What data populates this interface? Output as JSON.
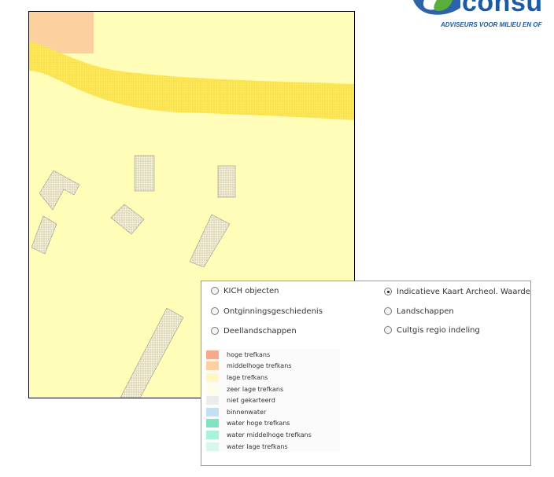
{
  "logo": {
    "text": "consu",
    "tagline": "ADVISEURS VOOR MILIEU EN OF"
  },
  "map": {
    "background_color": "#fffdb8",
    "band_color": "#fde85a",
    "corner_patch_color": "#fdd0a0",
    "polygon_fill": "#f0e9cc"
  },
  "layers": {
    "options": [
      {
        "label": "KICH objecten",
        "selected": false
      },
      {
        "label": "Indicatieve Kaart Archeol. Waarde",
        "selected": true
      },
      {
        "label": "Ontginningsgeschiedenis",
        "selected": false
      },
      {
        "label": "Landschappen",
        "selected": false
      },
      {
        "label": "Deellandschappen",
        "selected": false
      },
      {
        "label": "Cultgis regio indeling",
        "selected": false
      }
    ]
  },
  "legend": {
    "items": [
      {
        "label": "hoge trefkans",
        "color": "#f7a98b"
      },
      {
        "label": "middelhoge trefkans",
        "color": "#fdd0a0"
      },
      {
        "label": "lage trefkans",
        "color": "#fff8c0"
      },
      {
        "label": "zeer lage trefkans",
        "color": "#fffde8"
      },
      {
        "label": "niet gekarteerd",
        "color": "#ececec"
      },
      {
        "label": "binnenwater",
        "color": "#bfe0f7"
      },
      {
        "label": "water hoge trefkans",
        "color": "#7fe3c4"
      },
      {
        "label": "water middelhoge trefkans",
        "color": "#a8f2da"
      },
      {
        "label": "water lage trefkans",
        "color": "#d6f8ea"
      }
    ]
  }
}
